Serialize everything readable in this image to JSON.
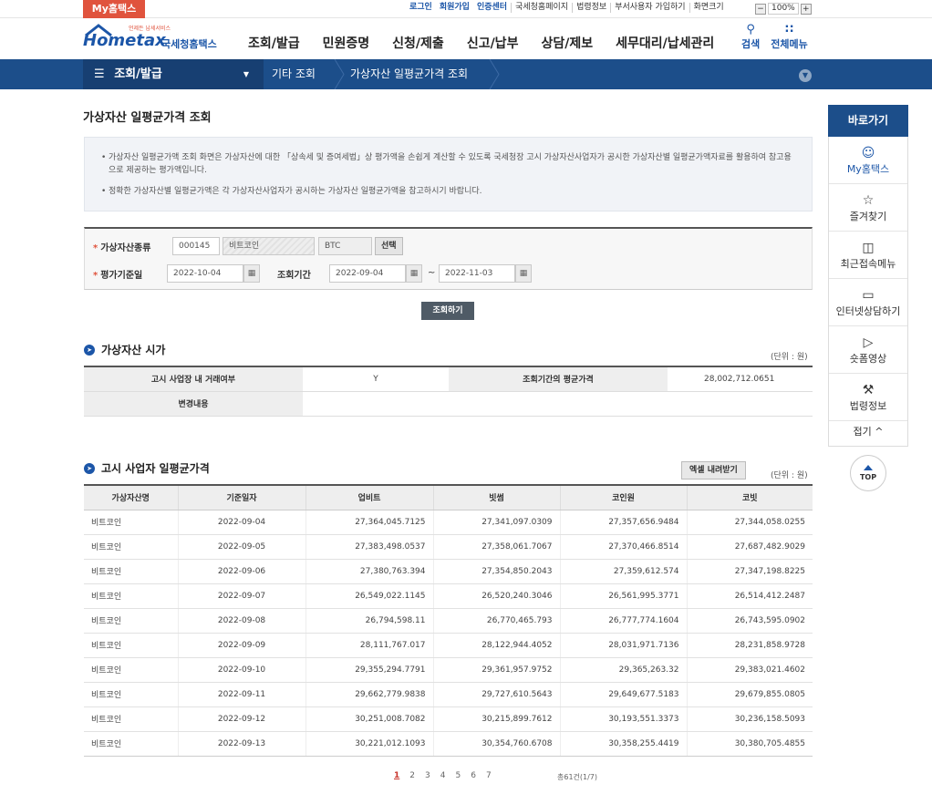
{
  "util": {
    "my_hometax": "My홈택스",
    "links": [
      "로그인",
      "회원가입",
      "인증센터",
      "국세청홈페이지",
      "법령정보",
      "부서사용자 가입하기",
      "화면크기"
    ],
    "zoom_minus": "−",
    "zoom_value": "100%",
    "zoom_plus": "+"
  },
  "logo": {
    "small": "언제든 납세서비스",
    "brand": "Hometax",
    "kr": "국세청홈택스"
  },
  "menu": [
    "조회/발급",
    "민원증명",
    "신청/제출",
    "신고/납부",
    "상담/제보",
    "세무대리/납세관리"
  ],
  "tools": {
    "search_label": "검색",
    "all_menu_label": "전체메뉴"
  },
  "nav": {
    "first": "조회/발급",
    "crumb1": "기타 조회",
    "crumb2": "가상자산 일평균가격 조회"
  },
  "page_title": "가상자산 일평균가격 조회",
  "notice": [
    "가상자산 일평균가액 조회 화면은 가상자산에 대한 「상속세 및 증여세법」상 평가액을 손쉽게 계산할 수 있도록 국세청장 고시 가상자산사업자가 공시한 가상자산별 일평균가액자료를 활용하여 참고용으로 제공하는 평가액입니다.",
    "정확한 가상자산별 일평균가액은 각 가상자산사업자가 공시하는 가상자산 일평균가액을 참고하시기 바랍니다."
  ],
  "form": {
    "asset_type_label": "가상자산종류",
    "asset_code": "000145",
    "asset_name": "비트코인",
    "asset_symbol": "BTC",
    "select_button": "선택",
    "eval_date_label": "평가기준일",
    "eval_date": "2022-10-04",
    "period_label": "조회기간",
    "period_from": "2022-09-04",
    "tilde": "~",
    "period_to": "2022-11-03",
    "search_button": "조회하기"
  },
  "section1": {
    "title": "가상자산 시가",
    "unit": "(단위 : 원)",
    "listed_label": "고시 사업장 내 거래여부",
    "listed_value": "Y",
    "avg_label": "조회기간의 평균가격",
    "avg_value": "28,002,712.0651",
    "change_label": "변경내용",
    "change_value": ""
  },
  "section2": {
    "title": "고시 사업자 일평균가격",
    "excel_button": "엑셀 내려받기",
    "unit": "(단위 : 원)",
    "headers": [
      "가상자산명",
      "기준일자",
      "업비트",
      "빗썸",
      "코인원",
      "코빗"
    ],
    "rows": [
      [
        "비트코인",
        "2022-09-04",
        "27,364,045.7125",
        "27,341,097.0309",
        "27,357,656.9484",
        "27,344,058.0255"
      ],
      [
        "비트코인",
        "2022-09-05",
        "27,383,498.0537",
        "27,358,061.7067",
        "27,370,466.8514",
        "27,687,482.9029"
      ],
      [
        "비트코인",
        "2022-09-06",
        "27,380,763.394",
        "27,354,850.2043",
        "27,359,612.574",
        "27,347,198.8225"
      ],
      [
        "비트코인",
        "2022-09-07",
        "26,549,022.1145",
        "26,520,240.3046",
        "26,561,995.3771",
        "26,514,412.2487"
      ],
      [
        "비트코인",
        "2022-09-08",
        "26,794,598.11",
        "26,770,465.793",
        "26,777,774.1604",
        "26,743,595.0902"
      ],
      [
        "비트코인",
        "2022-09-09",
        "28,111,767.017",
        "28,122,944.4052",
        "28,031,971.7136",
        "28,231,858.9728"
      ],
      [
        "비트코인",
        "2022-09-10",
        "29,355,294.7791",
        "29,361,957.9752",
        "29,365,263.32",
        "29,383,021.4602"
      ],
      [
        "비트코인",
        "2022-09-11",
        "29,662,779.9838",
        "29,727,610.5643",
        "29,649,677.5183",
        "29,679,855.0805"
      ],
      [
        "비트코인",
        "2022-09-12",
        "30,251,008.7082",
        "30,215,899.7612",
        "30,193,551.3373",
        "30,236,158.5093"
      ],
      [
        "비트코인",
        "2022-09-13",
        "30,221,012.1093",
        "30,354,760.6708",
        "30,358,255.4419",
        "30,380,705.4855"
      ]
    ]
  },
  "pager": {
    "pages": [
      "1",
      "2",
      "3",
      "4",
      "5",
      "6",
      "7"
    ],
    "current": "1",
    "total": "총61건(1/7)"
  },
  "side": {
    "header": "바로가기",
    "items": [
      "My홈택스",
      "즐겨찾기",
      "최근접속메뉴",
      "인터넷상담하기",
      "숏폼영상",
      "법령정보"
    ],
    "close": "접기 ^",
    "top": "TOP"
  }
}
